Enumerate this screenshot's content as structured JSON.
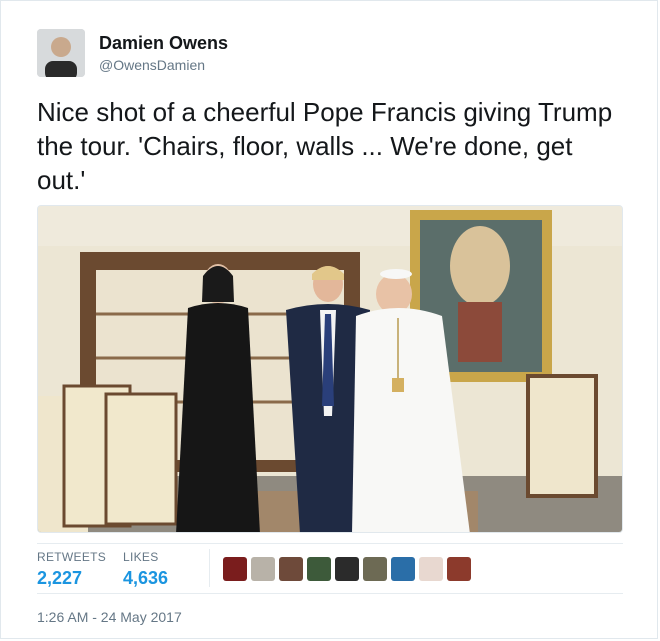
{
  "author": {
    "name": "Damien Owens",
    "handle": "@OwensDamien"
  },
  "tweet": {
    "text": "Nice shot of a cheerful Pope Francis giving Trump the tour. 'Chairs, floor, walls ... We're done, get out.'"
  },
  "stats": {
    "retweets_label": "RETWEETS",
    "retweets_value": "2,227",
    "likes_label": "LIKES",
    "likes_value": "4,636"
  },
  "likers": [
    {
      "color": "#7a1d1d"
    },
    {
      "color": "#b8b2a8"
    },
    {
      "color": "#6e4a3a"
    },
    {
      "color": "#3d5a3a"
    },
    {
      "color": "#2b2b2b"
    },
    {
      "color": "#6d6a54"
    },
    {
      "color": "#2a6ea8"
    },
    {
      "color": "#e8d8d0"
    },
    {
      "color": "#8c3a2c"
    }
  ],
  "timestamp": "1:26 AM - 24 May 2017",
  "colors": {
    "accent": "#1b95e0",
    "secondary_text": "#657786",
    "border": "#e1e8ed"
  },
  "icons": {
    "avatar": "profile-photo",
    "photo": "vatican-photo"
  }
}
